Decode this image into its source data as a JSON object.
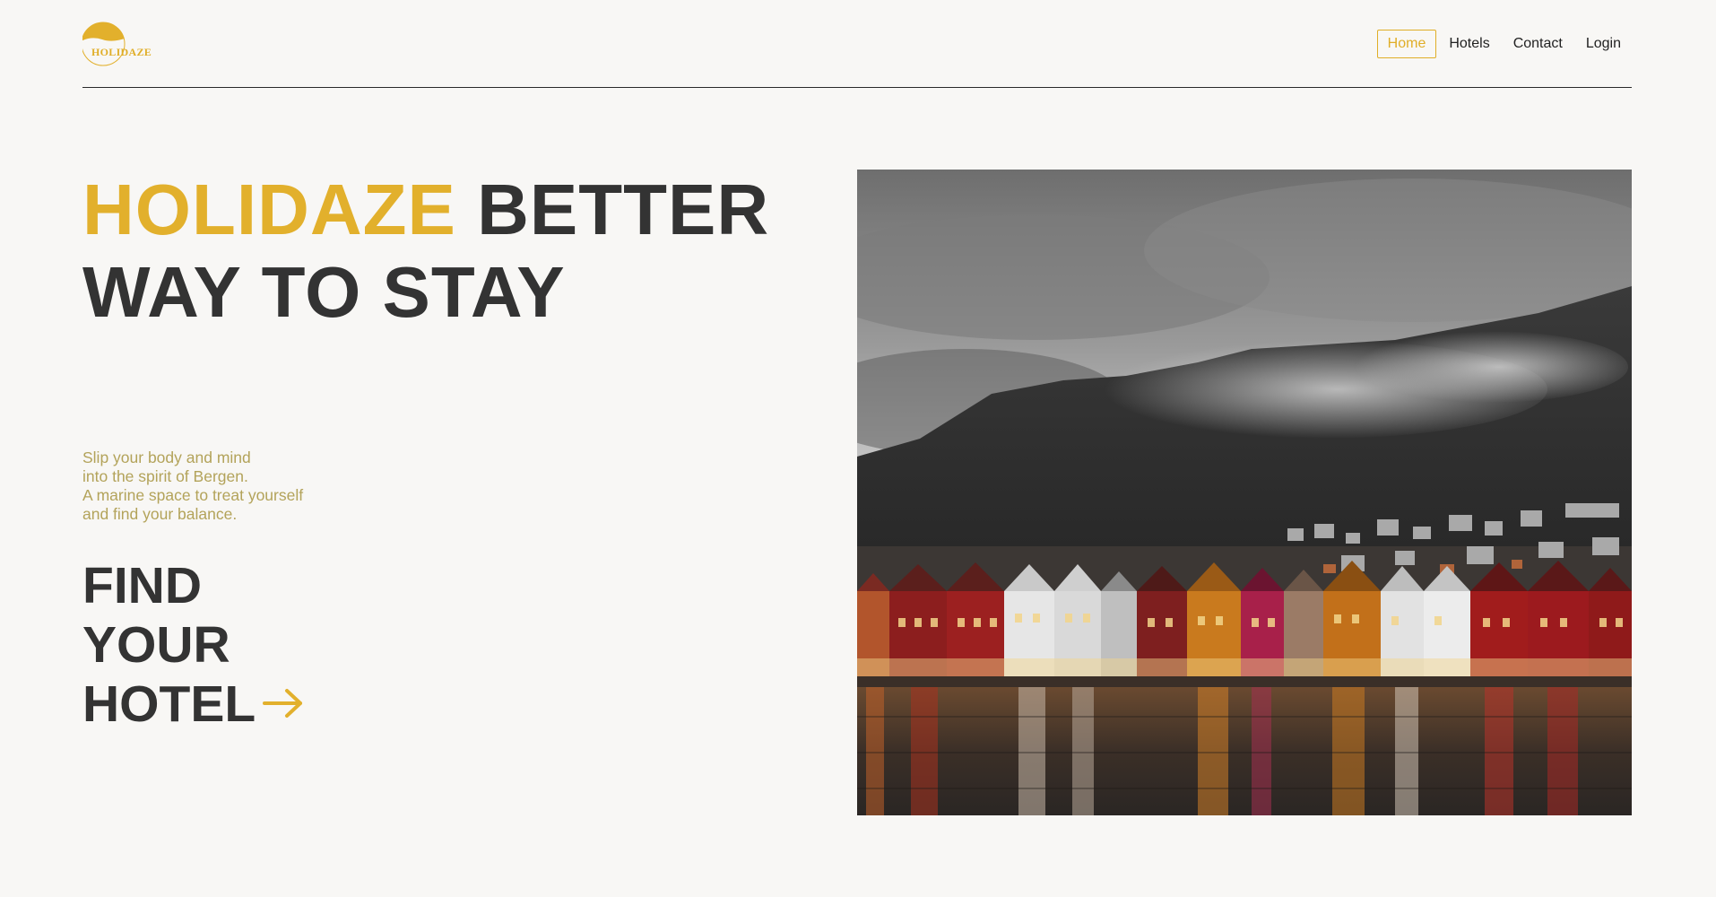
{
  "brand": {
    "logo_text": "HOLIDAZE",
    "accent_color": "#e2b02c"
  },
  "nav": {
    "items": [
      {
        "label": "Home",
        "active": true
      },
      {
        "label": "Hotels",
        "active": false
      },
      {
        "label": "Contact",
        "active": false
      },
      {
        "label": "Login",
        "active": false
      }
    ]
  },
  "hero": {
    "title_accent": "HOLIDAZE",
    "title_rest_line1": "BETTER",
    "title_line2": "WAY TO STAY",
    "tagline": [
      "Slip your body and mind",
      "into the spirit of Bergen.",
      "A marine space to treat yourself",
      "and find your balance."
    ],
    "cta_lines": [
      "FIND",
      "YOUR",
      "HOTEL"
    ],
    "cta_icon": "arrow-right-icon",
    "image_icon": "bergen-harbor-photo"
  }
}
